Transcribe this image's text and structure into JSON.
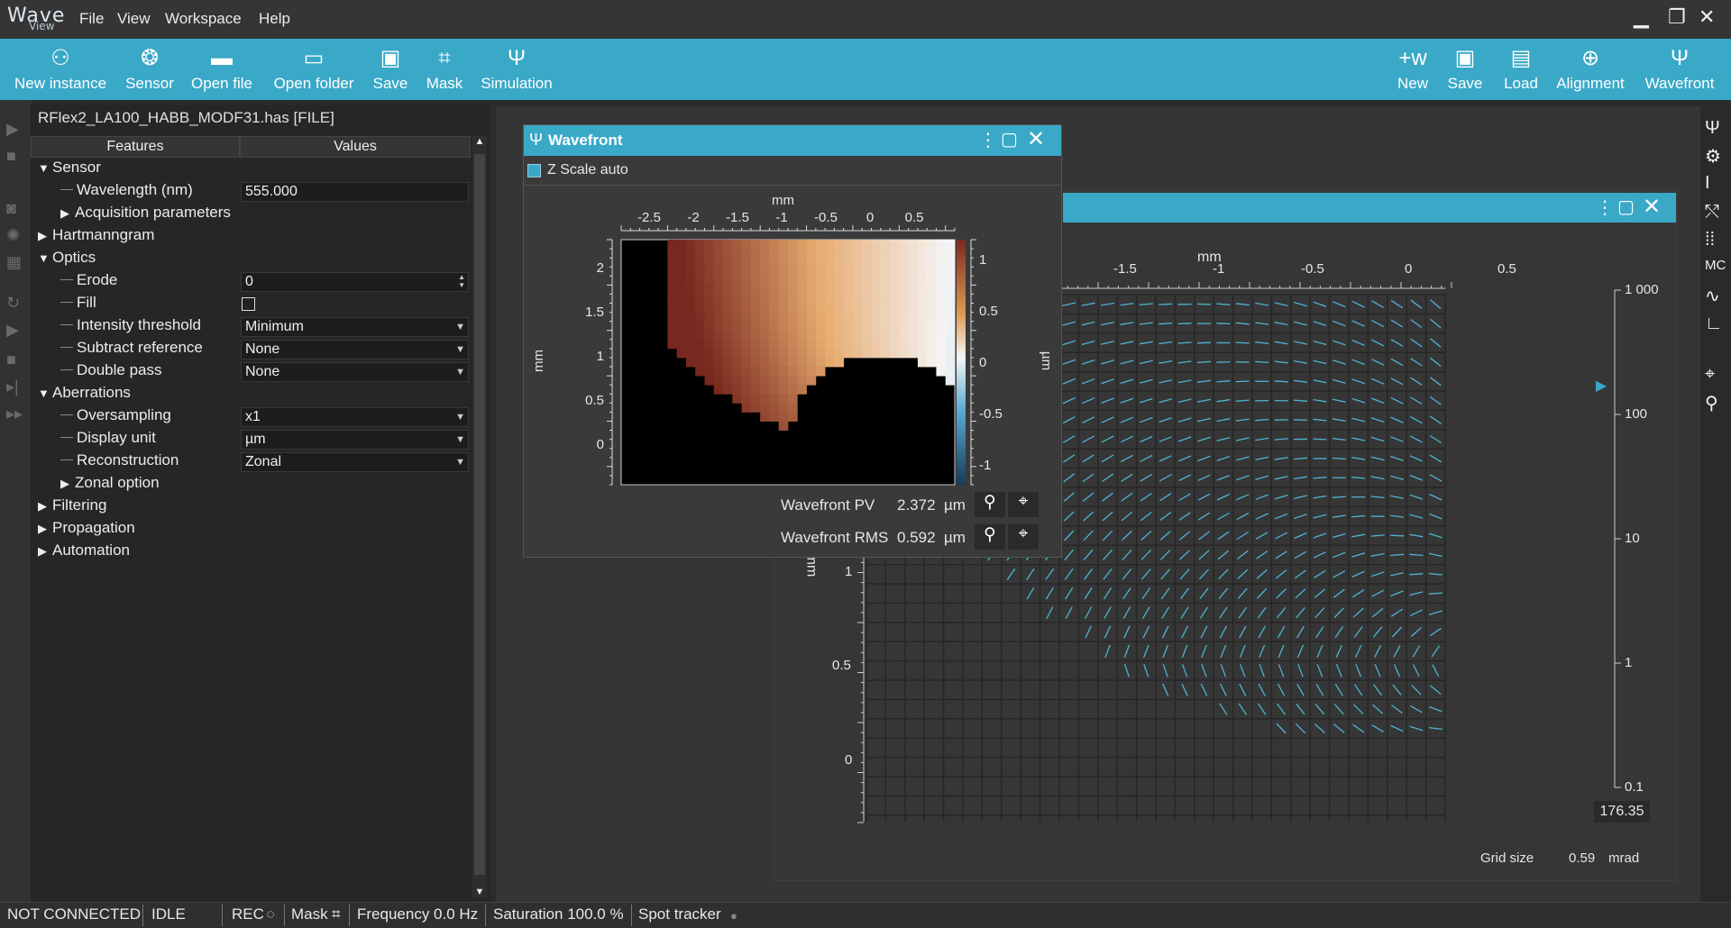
{
  "app": {
    "logo_main": "Wave",
    "logo_sub": "View",
    "menu": [
      "File",
      "View",
      "Workspace",
      "Help"
    ]
  },
  "toolbar_left": [
    {
      "label": "New instance",
      "icon": "new-instance-icon"
    },
    {
      "label": "Sensor",
      "icon": "aperture-icon"
    },
    {
      "label": "Open file",
      "icon": "folder-icon"
    },
    {
      "label": "Open folder",
      "icon": "folder-open-icon"
    },
    {
      "label": "Save",
      "icon": "save-icon"
    },
    {
      "label": "Mask",
      "icon": "crop-icon"
    },
    {
      "label": "Simulation",
      "icon": "psi-icon"
    }
  ],
  "toolbar_right": [
    {
      "label": "New",
      "icon": "new-wavefront-icon"
    },
    {
      "label": "Save",
      "icon": "save-wavefront-icon"
    },
    {
      "label": "Load",
      "icon": "load-wavefront-icon"
    },
    {
      "label": "Alignment",
      "icon": "alignment-icon"
    },
    {
      "label": "Wavefront",
      "icon": "wavefront-icon"
    }
  ],
  "panel": {
    "title": "RFlex2_LA100_HABB_MODF31.has [FILE]",
    "col_features": "Features",
    "col_values": "Values",
    "rows": [
      {
        "label": "Sensor",
        "level": 0,
        "arrow": "down"
      },
      {
        "label": "Wavelength (nm)",
        "level": 1,
        "value": "555.000",
        "kind": "text"
      },
      {
        "label": "Acquisition parameters",
        "level": 1,
        "arrow": "right"
      },
      {
        "label": "Hartmanngram",
        "level": 0,
        "arrow": "right"
      },
      {
        "label": "Optics",
        "level": 0,
        "arrow": "down"
      },
      {
        "label": "Erode",
        "level": 1,
        "value": "0",
        "kind": "spin"
      },
      {
        "label": "Fill",
        "level": 1,
        "value": "",
        "kind": "check"
      },
      {
        "label": "Intensity threshold",
        "level": 1,
        "value": "Minimum",
        "kind": "select"
      },
      {
        "label": "Subtract reference",
        "level": 1,
        "value": "None",
        "kind": "select"
      },
      {
        "label": "Double pass",
        "level": 1,
        "value": "None",
        "kind": "select"
      },
      {
        "label": "Aberrations",
        "level": 0,
        "arrow": "down"
      },
      {
        "label": "Oversampling",
        "level": 1,
        "value": "x1",
        "kind": "select"
      },
      {
        "label": "Display unit",
        "level": 1,
        "value": "µm",
        "kind": "select"
      },
      {
        "label": "Reconstruction",
        "level": 1,
        "value": "Zonal",
        "kind": "select"
      },
      {
        "label": "Zonal option",
        "level": 1,
        "arrow": "right"
      },
      {
        "label": "Filtering",
        "level": 0,
        "arrow": "right"
      },
      {
        "label": "Propagation",
        "level": 0,
        "arrow": "right"
      },
      {
        "label": "Automation",
        "level": 0,
        "arrow": "right"
      }
    ]
  },
  "wavefront_window": {
    "title": "Wavefront",
    "z_scale_label": "Z Scale auto",
    "x_unit": "mm",
    "y_unit": "mm",
    "cb_unit": "µm",
    "x_ticks": [
      "-2.5",
      "-2",
      "-1.5",
      "-1",
      "-0.5",
      "0",
      "0.5"
    ],
    "y_ticks": [
      "2",
      "1.5",
      "1",
      "0.5",
      "0"
    ],
    "cb_ticks": [
      "1",
      "0.5",
      "0",
      "-0.5",
      "-1"
    ],
    "pv_label": "Wavefront PV",
    "pv_value": "2.372",
    "pv_unit": "µm",
    "rms_label": "Wavefront RMS",
    "rms_value": "0.592",
    "rms_unit": "µm"
  },
  "slope_window": {
    "x_unit": "mm",
    "y_unit": "mm",
    "x_ticks": [
      "-1.5",
      "-1",
      "-0.5",
      "0",
      "0.5"
    ],
    "y_ticks": [
      "1",
      "0.5",
      "0"
    ],
    "scale_ticks": [
      "1 000",
      "100",
      "10",
      "1",
      "0.1"
    ],
    "scale_value": "176.35",
    "grid_size_label": "Grid size",
    "grid_size_value": "0.59",
    "grid_size_unit": "mrad"
  },
  "status": {
    "connection": "NOT CONNECTED",
    "state": "IDLE",
    "rec": "REC",
    "mask": "Mask",
    "frequency": "Frequency 0.0 Hz",
    "saturation": "Saturation 100.0 %",
    "spot_tracker": "Spot tracker"
  },
  "colors": {
    "accent": "#3aa8c7",
    "background": "#2b2b2b",
    "panel": "#262626"
  }
}
